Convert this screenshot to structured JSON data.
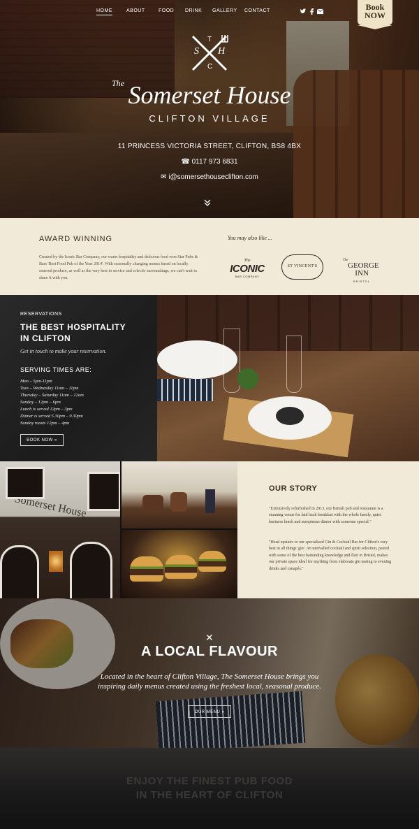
{
  "nav": {
    "items": [
      "HOME",
      "ABOUT",
      "FOOD",
      "DRINK",
      "GALLERY",
      "CONTACT"
    ],
    "active": "HOME",
    "book_line1": "Book",
    "book_line2": "NOW",
    "social_icons": [
      "twitter-icon",
      "facebook-icon",
      "mail-icon"
    ]
  },
  "hero": {
    "monogram": [
      "S",
      "T",
      "C",
      "H"
    ],
    "title_prefix": "The",
    "title": "Somerset House",
    "subtitle": "CLIFTON VILLAGE",
    "address": "11 PRINCESS VICTORIA STREET, CLIFTON, BS8 4BX",
    "phone": "0117 973 6831",
    "email": "i@somersethouseclifton.com"
  },
  "award": {
    "heading": "AWARD WINNING",
    "text": "Created by the Iconic Bar Company, our warm hospitality and delicious food won Star Pubs & Bars 'Best Food Pub of the Year 2014'. With seasonally changing menus based on locally sourced produce, as well as the very best in service and eclectic surroundings, we can't wait to share it with you.",
    "also_like": "You may also like ...",
    "brands": [
      {
        "pre": "The",
        "name": "ICONIC",
        "sub": "BAR COMPANY"
      },
      {
        "pre": "",
        "name": "ST VINCENT'S",
        "sub": ""
      },
      {
        "pre": "The",
        "name": "GEORGE INN",
        "sub": "BRISTOL"
      }
    ]
  },
  "reservations": {
    "tag": "RESERVATIONS",
    "heading_line1": "THE BEST HOSPITALITY",
    "heading_line2": "IN CLIFTON",
    "intro": "Get in touch to make your reservation.",
    "serving_title": "SERVING TIMES ARE:",
    "hours": [
      "Mon – 5pm-11pm",
      "Tues – Wednesday 11am – 11pm",
      "Thursday – Saturday 11am – 12am",
      "Sunday – 12pm – 6pm",
      "Lunch is served 12pm – 3pm",
      "Dinner is served 5.30pm – 9.30pm",
      "Sunday roasts 12pm – 4pm"
    ],
    "button": "BOOK NOW »"
  },
  "story": {
    "heading": "OUR STORY",
    "para1": "\"Extensively refurbished in 2013, our British pub and restaurant is a stunning venue for laid back breakfast with the whole family, quiet business lunch and sumptuous dinner with someone special.\"",
    "para2": "\"Head upstairs to our specialised Gin & Cocktail Bar for Clifton's very best in all things 'gin'. An unrivalled cocktail and spirit selection, paired with some of the best bartending knowledge and flair in Bristol, makes our private space ideal for anything from elaborate gin tasting to evening drinks and canapés.\"",
    "house_sign": "Somerset House"
  },
  "local": {
    "heading": "A LOCAL FLAVOUR",
    "line1": "Located in the heart of Clifton Village, The Somerset House brings you",
    "line2": "inspiring daily menus created using the freshest local, seasonal produce.",
    "button": "OUR MENU »"
  },
  "bottom": {
    "line1": "ENJOY THE FINEST PUB FOOD",
    "line2": "IN THE HEART OF CLIFTON"
  }
}
